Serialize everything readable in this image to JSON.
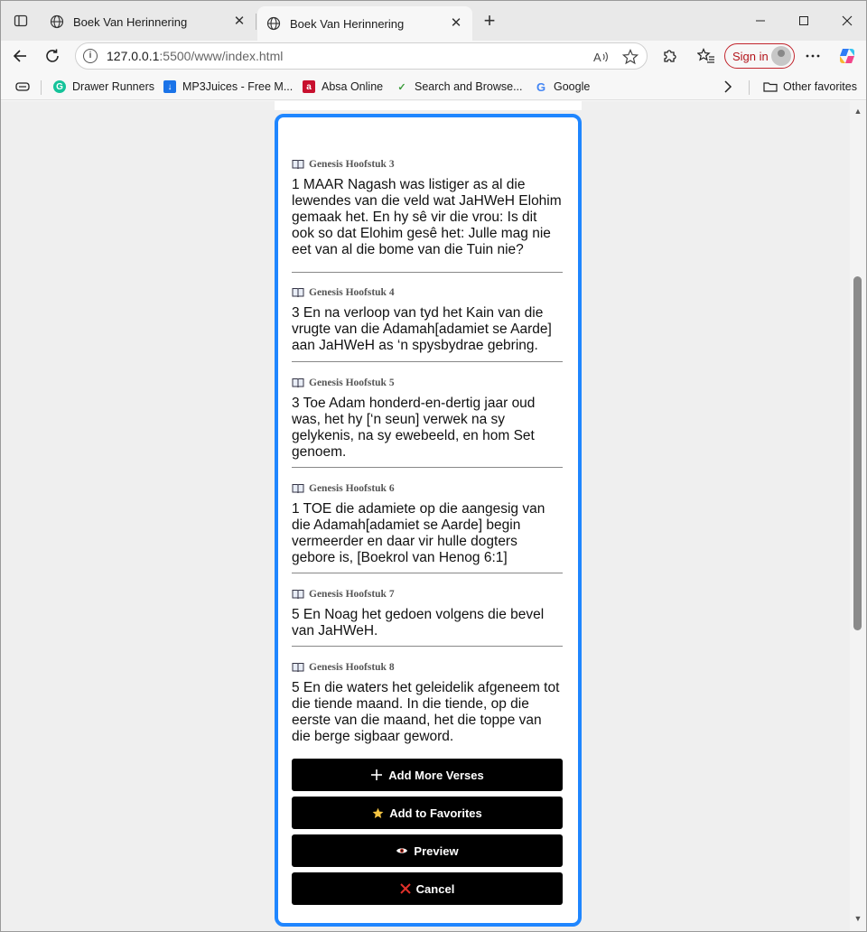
{
  "browser": {
    "tabs": [
      {
        "title": "Boek Van Herinnering",
        "close": "✕"
      },
      {
        "title": "Boek Van Herinnering",
        "close": "✕"
      }
    ],
    "new_tab": "+",
    "url_host": "127.0.0.1",
    "url_rest": ":5500/www/index.html",
    "sign_in": "Sign in",
    "favorites": [
      {
        "label": "Drawer Runners",
        "icon": "grammarly-g-icon",
        "color": "#15c39a"
      },
      {
        "label": "MP3Juices - Free M...",
        "icon": "download-icon",
        "color": "#1a73e8"
      },
      {
        "label": "Absa Online",
        "icon": "absa-logo-icon",
        "color": "#c8102e"
      },
      {
        "label": "Search and Browse...",
        "icon": "site-logo-icon",
        "color": "#3a9b3a"
      },
      {
        "label": "Google",
        "icon": "google-g-icon",
        "color": "#4285f4"
      }
    ],
    "other_favorites": "Other favorites"
  },
  "verses": [
    {
      "heading": "Genesis Hoofstuk 3",
      "text": "1 MAAR Nagash was listiger as al die lewendes van die veld wat JaHWeH Elohim gemaak het. En hy sê vir die vrou: Is dit ook so dat Elohim gesê het: Julle mag nie eet van al die bome van die Tuin nie?"
    },
    {
      "heading": "Genesis Hoofstuk 4",
      "text": "3 En na verloop van tyd het Kain van die vrugte van die Adamah[adamiet se Aarde] aan JaHWeH as ‘n spysbydrae gebring."
    },
    {
      "heading": "Genesis Hoofstuk 5",
      "text": "3 Toe Adam honderd-en-dertig jaar oud was, het hy [‘n seun] verwek na sy gelykenis, na sy ewebeeld, en hom Set genoem."
    },
    {
      "heading": "Genesis Hoofstuk 6",
      "text": "1 TOE die adamiete op die aangesig van die Adamah[adamiet se Aarde] begin vermeerder en daar vir hulle dogters gebore is, [Boekrol van Henog 6:1]"
    },
    {
      "heading": "Genesis Hoofstuk 7",
      "text": "5 En Noag het gedoen volgens die bevel van JaHWeH."
    },
    {
      "heading": "Genesis Hoofstuk 8",
      "text": "5 En die waters het geleidelik afgeneem tot die tiende maand. In die tiende, op die eerste van die maand, het die toppe van die berge sigbaar geword."
    }
  ],
  "actions": {
    "add_more": {
      "label": "Add More Verses",
      "icon": "plus-icon"
    },
    "favorites": {
      "label": "Add to Favorites",
      "icon": "star-icon",
      "color": "#f5c542"
    },
    "preview": {
      "label": "Preview",
      "icon": "eye-icon"
    },
    "cancel": {
      "label": "Cancel",
      "icon": "x-icon",
      "color": "#e0302a"
    }
  },
  "accent_color": "#1f86ff"
}
